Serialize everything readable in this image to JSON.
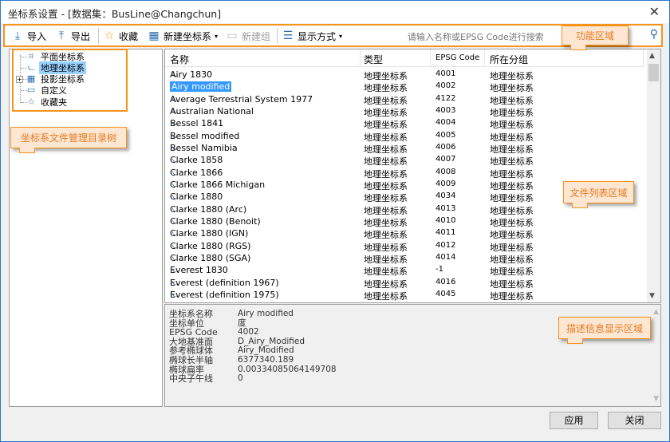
{
  "window": {
    "title": "坐标系设置 - [数据集：BusLine@Changchun]",
    "close_icon": "close-icon"
  },
  "toolbar": {
    "import": "导入",
    "export": "导出",
    "favorite": "收藏",
    "new_cs": "新建坐标系",
    "new_group": "新建组",
    "display_mode": "显示方式",
    "search_placeholder": "请输入名称或EPSG Code进行搜索"
  },
  "tree": {
    "items": [
      {
        "label": "平面坐标系"
      },
      {
        "label": "地理坐标系",
        "selected": true
      },
      {
        "label": "投影坐标系",
        "expandable": true
      },
      {
        "label": "自定义"
      },
      {
        "label": "收藏夹"
      }
    ]
  },
  "list": {
    "columns": [
      "名称",
      "类型",
      "EPSG Code",
      "所在分组"
    ],
    "rows": [
      [
        "Airy 1830",
        "地理坐标系",
        "4001",
        "地理坐标系"
      ],
      [
        "Airy modified",
        "地理坐标系",
        "4002",
        "地理坐标系"
      ],
      [
        "Average Terrestrial System 1977",
        "地理坐标系",
        "4122",
        "地理坐标系"
      ],
      [
        "Australian National",
        "地理坐标系",
        "4003",
        "地理坐标系"
      ],
      [
        "Bessel 1841",
        "地理坐标系",
        "4004",
        "地理坐标系"
      ],
      [
        "Bessel modified",
        "地理坐标系",
        "4005",
        "地理坐标系"
      ],
      [
        "Bessel Namibia",
        "地理坐标系",
        "4006",
        "地理坐标系"
      ],
      [
        "Clarke 1858",
        "地理坐标系",
        "4007",
        "地理坐标系"
      ],
      [
        "Clarke 1866",
        "地理坐标系",
        "4008",
        "地理坐标系"
      ],
      [
        "Clarke 1866 Michigan",
        "地理坐标系",
        "4009",
        "地理坐标系"
      ],
      [
        "Clarke 1880",
        "地理坐标系",
        "4034",
        "地理坐标系"
      ],
      [
        "Clarke 1880 (Arc)",
        "地理坐标系",
        "4013",
        "地理坐标系"
      ],
      [
        "Clarke 1880 (Benoit)",
        "地理坐标系",
        "4010",
        "地理坐标系"
      ],
      [
        "Clarke 1880 (IGN)",
        "地理坐标系",
        "4011",
        "地理坐标系"
      ],
      [
        "Clarke 1880 (RGS)",
        "地理坐标系",
        "4012",
        "地理坐标系"
      ],
      [
        "Clarke 1880 (SGA)",
        "地理坐标系",
        "4014",
        "地理坐标系"
      ],
      [
        "Everest 1830",
        "地理坐标系",
        "-1",
        "地理坐标系"
      ],
      [
        "Everest (definition 1967)",
        "地理坐标系",
        "4016",
        "地理坐标系"
      ],
      [
        "Everest (definition 1975)",
        "地理坐标系",
        "4045",
        "地理坐标系"
      ]
    ],
    "selected_index": 1
  },
  "description": {
    "rows": [
      [
        "坐标系名称",
        "Airy modified"
      ],
      [
        "坐标单位",
        "度"
      ],
      [
        "EPSG Code",
        "4002"
      ],
      [
        "大地基准面",
        "D_Airy_Modified"
      ],
      [
        "参考椭球体",
        "Airy_Modified"
      ],
      [
        "椭球长半轴",
        "6377340.189"
      ],
      [
        "椭球扁率",
        "0.00334085064149708"
      ],
      [
        "中央子午线",
        "0"
      ]
    ]
  },
  "buttons": {
    "apply": "应用",
    "close": "关闭"
  },
  "callouts": {
    "toolbar": "功能区域",
    "tree": "坐标系文件管理目录树",
    "list": "文件列表区域",
    "desc": "描述信息显示区域"
  },
  "colors": {
    "highlight": "#f7941d",
    "selection": "#3399ff",
    "tree_selection": "#99d1ff"
  }
}
